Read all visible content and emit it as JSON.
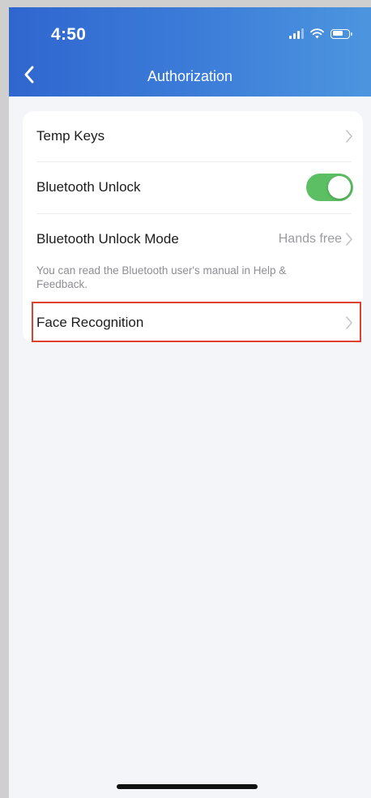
{
  "status_bar": {
    "time": "4:50",
    "icons": [
      "signal-icon",
      "wifi-icon",
      "battery-icon"
    ]
  },
  "nav": {
    "back_icon": "chevron-left-icon",
    "title": "Authorization"
  },
  "settings": {
    "temp_keys": {
      "label": "Temp Keys",
      "icon": "chevron-right-icon"
    },
    "bluetooth_unlock": {
      "label": "Bluetooth Unlock",
      "enabled": true
    },
    "bluetooth_unlock_mode": {
      "label": "Bluetooth Unlock Mode",
      "value": "Hands free",
      "icon": "chevron-right-icon"
    },
    "hint": "You can read the Bluetooth user's manual in Help & Feedback.",
    "face_recognition": {
      "label": "Face Recognition",
      "icon": "chevron-right-icon",
      "highlighted": true
    }
  },
  "colors": {
    "header_gradient_start": "#2f66cf",
    "header_gradient_end": "#4c95de",
    "toggle_on": "#5cbf63",
    "highlight_border": "#e0402e",
    "background": "#f4f5f8"
  }
}
